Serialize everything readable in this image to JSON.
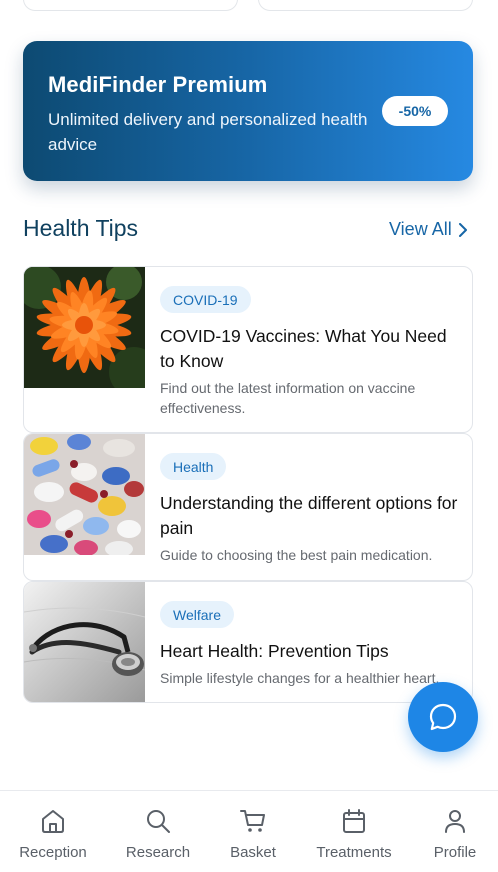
{
  "premium": {
    "title": "MediFinder Premium",
    "subtitle": "Unlimited delivery and personalized health advice",
    "discount": "-50%"
  },
  "health_tips": {
    "section_title": "Health Tips",
    "view_all_label": "View All",
    "items": [
      {
        "tag": "COVID-19",
        "title": "COVID-19 Vaccines: What You Need to Know",
        "description": "Find out the latest information on vaccine effectiveness."
      },
      {
        "tag": "Health",
        "title": "Understanding the different options for pain",
        "description": "Guide to choosing the best pain medication."
      },
      {
        "tag": "Welfare",
        "title": "Heart Health: Prevention Tips",
        "description": "Simple lifestyle changes for a healthier heart."
      }
    ]
  },
  "chat_fab": {
    "icon": "chat-bubble-icon"
  },
  "bottom_nav": {
    "items": [
      {
        "label": "Reception",
        "icon": "home-icon"
      },
      {
        "label": "Research",
        "icon": "search-icon"
      },
      {
        "label": "Basket",
        "icon": "cart-icon"
      },
      {
        "label": "Treatments",
        "icon": "calendar-icon"
      },
      {
        "label": "Profile",
        "icon": "user-icon"
      }
    ]
  },
  "colors": {
    "brand": "#1766a6",
    "fab": "#1e86e6",
    "heading": "#10415f",
    "tag_bg": "#e6f2fc"
  }
}
